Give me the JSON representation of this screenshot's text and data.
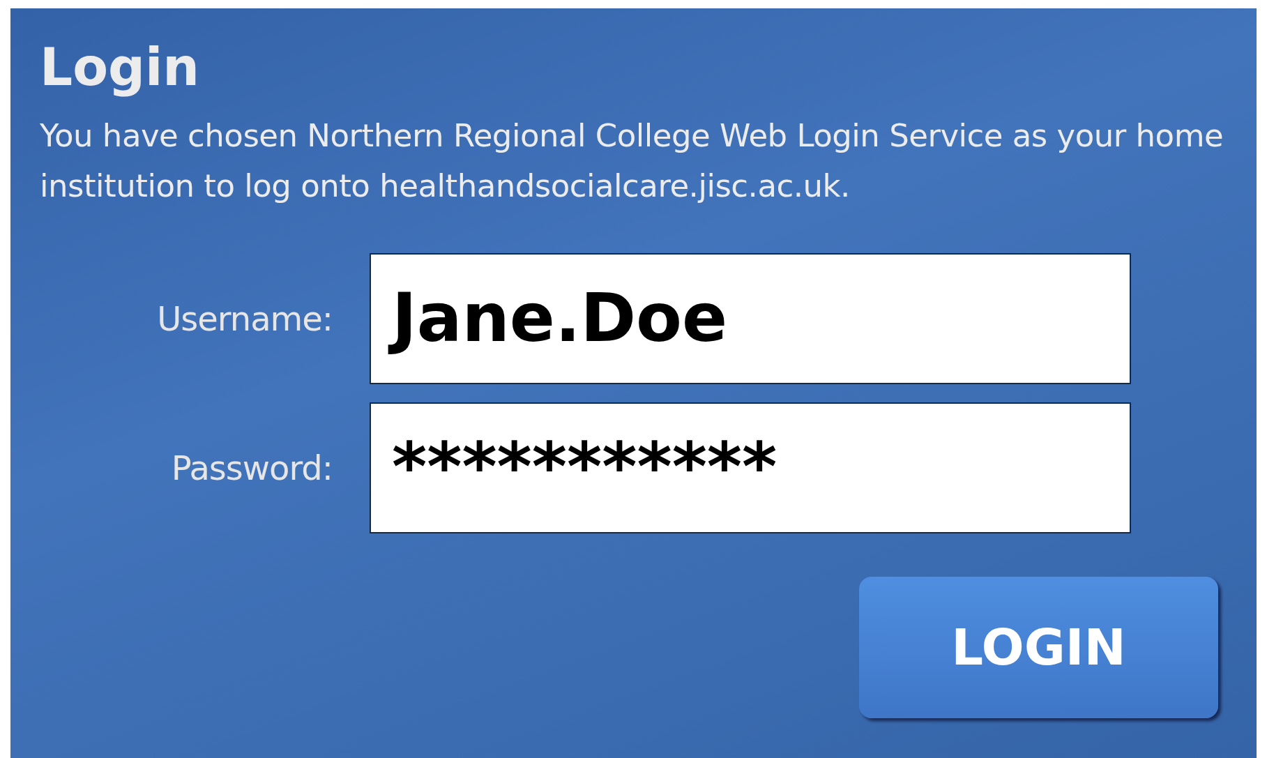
{
  "title": "Login",
  "description": "You have chosen Northern Regional College Web Login Service as your home institution to log onto healthandsocialcare.jisc.ac.uk.",
  "fields": [
    {
      "label": "Username:",
      "value": "Jane.Doe"
    },
    {
      "label": "Password:",
      "value": "***********"
    }
  ],
  "button": "LOGIN"
}
